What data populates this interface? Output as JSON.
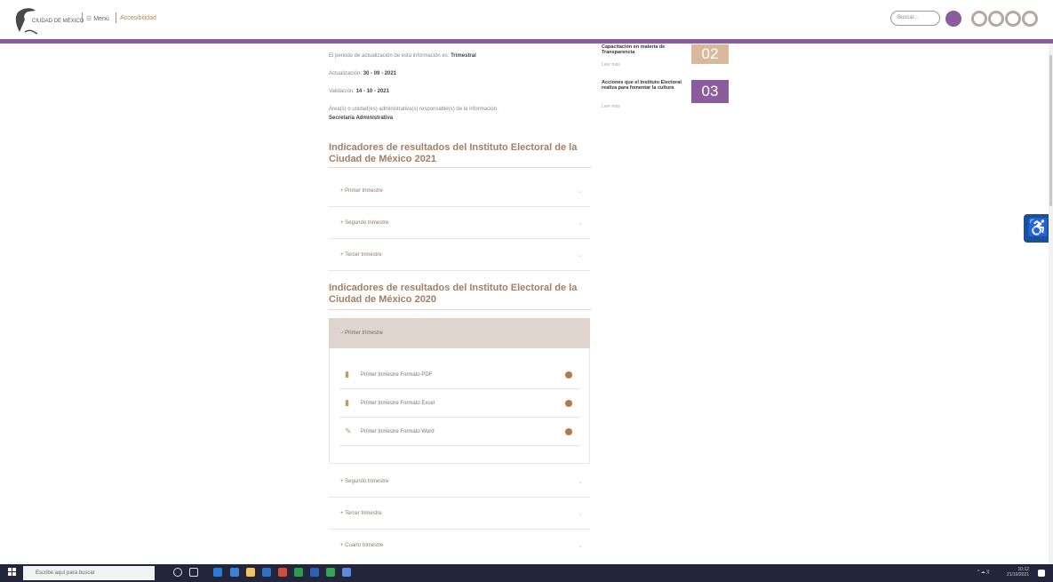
{
  "header": {
    "logo_text": "CIUDAD DE MÉXICO",
    "nav_menu": "Menú",
    "nav_accessibility": "Accesibilidad",
    "search_placeholder": "Buscar...",
    "social_icons": [
      "search-icon",
      "facebook-icon",
      "twitter-icon",
      "youtube-icon",
      "instagram-icon"
    ]
  },
  "info": {
    "line1_label": "El periodo de actualización de esta información es:",
    "line1_value": "Trimestral",
    "line2_label": "Actualización:",
    "line2_value": "30 - 09 - 2021",
    "line3_label": "Validación:",
    "line3_value": "14 - 10 - 2021",
    "line4_label": "Área(s) o unidad(es) administrativa(s) responsable(s) de la información:",
    "line4_value": "Secretaría Administrativa"
  },
  "section2021": {
    "heading": "Indicadores de resultados del Instituto Electoral de la Ciudad de México 2021",
    "items": [
      "Primer trimestre",
      "Segundo trimestre",
      "Tercer trimestre"
    ]
  },
  "section2020": {
    "heading": "Indicadores de resultados del Instituto Electoral de la Ciudad de México 2020",
    "open_item": "Primer trimestre",
    "files": [
      {
        "name": "Primer trimestre Formato PDF",
        "icon": "pdf-icon"
      },
      {
        "name": "Primer trimestre Formato Excel",
        "icon": "excel-icon"
      },
      {
        "name": "Primer trimestre Formato Word",
        "icon": "word-icon"
      }
    ],
    "items": [
      "Segundo trimestre",
      "Tercer trimestre",
      "Cuarto trimestre"
    ]
  },
  "sidebar": {
    "items": [
      {
        "title": "Capacitación en materia de Transparencia",
        "sub": "Leer más",
        "num": "02",
        "color": "#d9b99b"
      },
      {
        "title": "Acciones que el Instituto Electoral realiza para fomentar la cultura",
        "sub": "Leer más",
        "num": "03",
        "color": "#8c5d9c"
      }
    ]
  },
  "taskbar": {
    "search_placeholder": "Escribe aquí para buscar",
    "clock": "10:12",
    "date": "21/10/2021"
  },
  "colors": {
    "accent_purple": "#8c5d9c",
    "heading_brown": "#a47e63",
    "accessibility_blue": "#1b4f96"
  }
}
